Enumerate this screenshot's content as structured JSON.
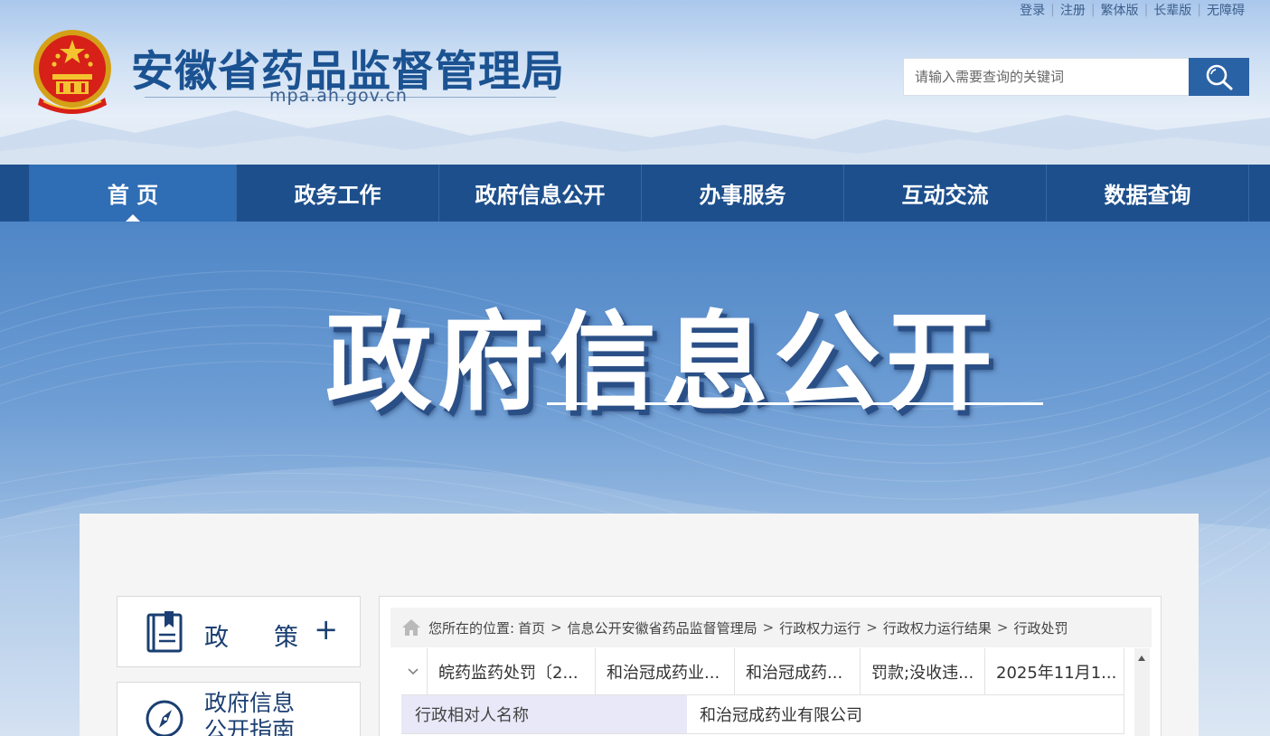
{
  "top_links": [
    "登录",
    "注册",
    "繁体版",
    "长辈版",
    "无障碍"
  ],
  "site": {
    "title": "安徽省药品监督管理局",
    "domain": "mpa.ah.gov.cn"
  },
  "search": {
    "placeholder": "请输入需要查询的关键词"
  },
  "nav": [
    "首 页",
    "政务工作",
    "政府信息公开",
    "办事服务",
    "互动交流",
    "数据查询"
  ],
  "banner": {
    "title": "政府信息公开"
  },
  "sidebar": {
    "policy_label_1": "政",
    "policy_label_2": "策",
    "policy_expand": "+",
    "guide_label_1": "政府信息",
    "guide_label_2": "公开指南"
  },
  "breadcrumb": {
    "prefix": "您所在的位置:",
    "items": [
      "首页",
      "信息公开安徽省药品监督管理局",
      "行政权力运行",
      "行政权力运行结果",
      "行政处罚"
    ],
    "separator": ">"
  },
  "record": {
    "summary": [
      "皖药监药处罚〔2...",
      "和治冠成药业...",
      "和治冠成药...",
      "罚款;没收违...",
      "2025年11月1..."
    ],
    "detail_key": "行政相对人名称",
    "detail_value": "和治冠成药业有限公司"
  },
  "colors": {
    "nav_bg": "#1d4f8c",
    "nav_active": "#2f6db5",
    "title_blue": "#1b5291",
    "search_btn": "#2a62a6"
  }
}
